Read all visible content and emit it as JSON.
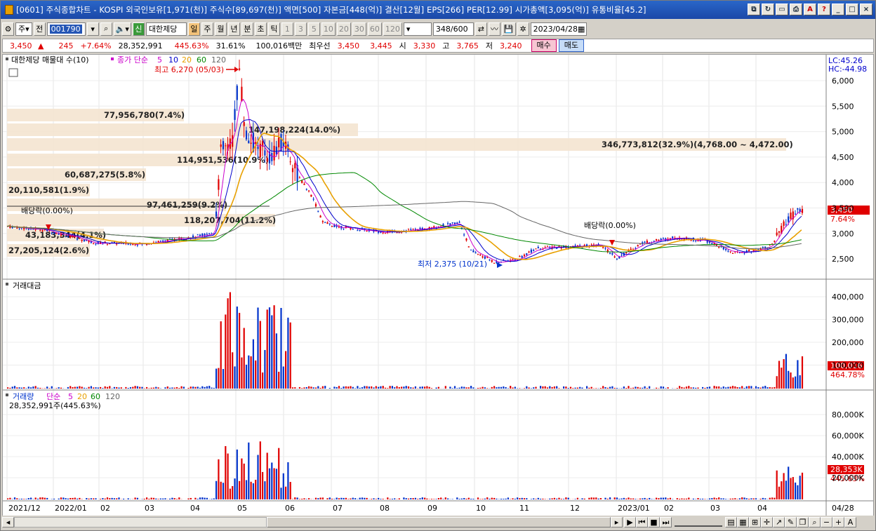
{
  "titlebar": {
    "title": "[0601] 주식종합차트 - KOSPI 외국인보유[1,971(천)] 주식수[89,697(천)] 액면[500] 자본금[448(억)] 결산[12월] EPS[266] PER[12.99] 시가총액[3,095(억)] 유통비율[45.2]"
  },
  "toolbar": {
    "period_label": "주",
    "prev_label": "전",
    "stock_code": "001790",
    "stock_name": "대한제당",
    "sin_label": "신",
    "timeframes": [
      "일",
      "주",
      "월",
      "년",
      "분",
      "초",
      "틱"
    ],
    "intervals": [
      "1",
      "3",
      "5",
      "10",
      "20",
      "30",
      "60",
      "120"
    ],
    "count": "348",
    "count_total": "/600",
    "date": "2023/04/28"
  },
  "info": {
    "price": "3,450",
    "change": "245",
    "change_pct": "+7.64%",
    "volume": "28,352,991",
    "volume_pct": "445.63%",
    "turnover": "31.61%",
    "amount": "100,016백만",
    "best_bid_label": "최우선",
    "ask": "3,450",
    "bid": "3,445",
    "open_label": "시",
    "open": "3,330",
    "high_label": "고",
    "high": "3,765",
    "low_label": "저",
    "low": "3,240",
    "buy_label": "매수",
    "sell_label": "매도"
  },
  "price_panel": {
    "legend_name": "대한제당 매물대 수(10)",
    "legend_ma": "종가 단순",
    "ma_periods": [
      "5",
      "10",
      "20",
      "60",
      "120"
    ],
    "ma_colors": [
      "#cc00cc",
      "#0000cc",
      "#e8a000",
      "#008800",
      "#666666"
    ],
    "lc": "LC:45.26",
    "hc": "HC:-44.98",
    "y_ticks": [
      "6,000",
      "5,500",
      "5,000",
      "4,500",
      "4,000",
      "3,500",
      "3,000",
      "2,500"
    ],
    "current_price_label": "3,450",
    "current_pct_label": "7.64%",
    "high_annotation": "최고 6,270 (05/03)",
    "low_annotation": "최저 2,375 (10/21)",
    "dividend_label": "배당락(0.00%)",
    "dividend_label2": "배당락(0.00%)",
    "volume_profile": [
      "77,956,780(7.4%)",
      "147,198,224(14.0%)",
      "346,773,812(32.9%)(4,768.00 ~ 4,472.00)",
      "114,951,536(10.9%)",
      "60,687,275(5.8%)",
      "20,110,581(1.9%)",
      "97,461,259(9.2%)",
      "118,207,704(11.2%)",
      "43,183,344(4.1%)",
      "27,205,124(2.6%)"
    ]
  },
  "amount_panel": {
    "title": "거래대금",
    "y_ticks": [
      "400,000",
      "300,000",
      "200,000",
      "100,000"
    ],
    "current_label": "100,016",
    "current_pct": "464.78%"
  },
  "volume_panel": {
    "title": "거래량",
    "legend_ma": "단순",
    "ma_periods": [
      "5",
      "20",
      "60",
      "120"
    ],
    "value_label": "28,352,991주(445.63%)",
    "y_ticks": [
      "80,000K",
      "60,000K",
      "40,000K",
      "20,000K"
    ],
    "current_label": "28,353K",
    "current_pct": "445.63%"
  },
  "x_axis": {
    "labels": [
      "2021/12",
      "2022/01",
      "02",
      "03",
      "04",
      "05",
      "06",
      "07",
      "08",
      "09",
      "10",
      "11",
      "12",
      "2023/01",
      "02",
      "03",
      "04"
    ],
    "end_label": "04/28"
  },
  "colors": {
    "up": "#e00000",
    "down": "#0033cc",
    "title_bg": "#1f50b0",
    "profile_bg": "#f4e4d0"
  }
}
